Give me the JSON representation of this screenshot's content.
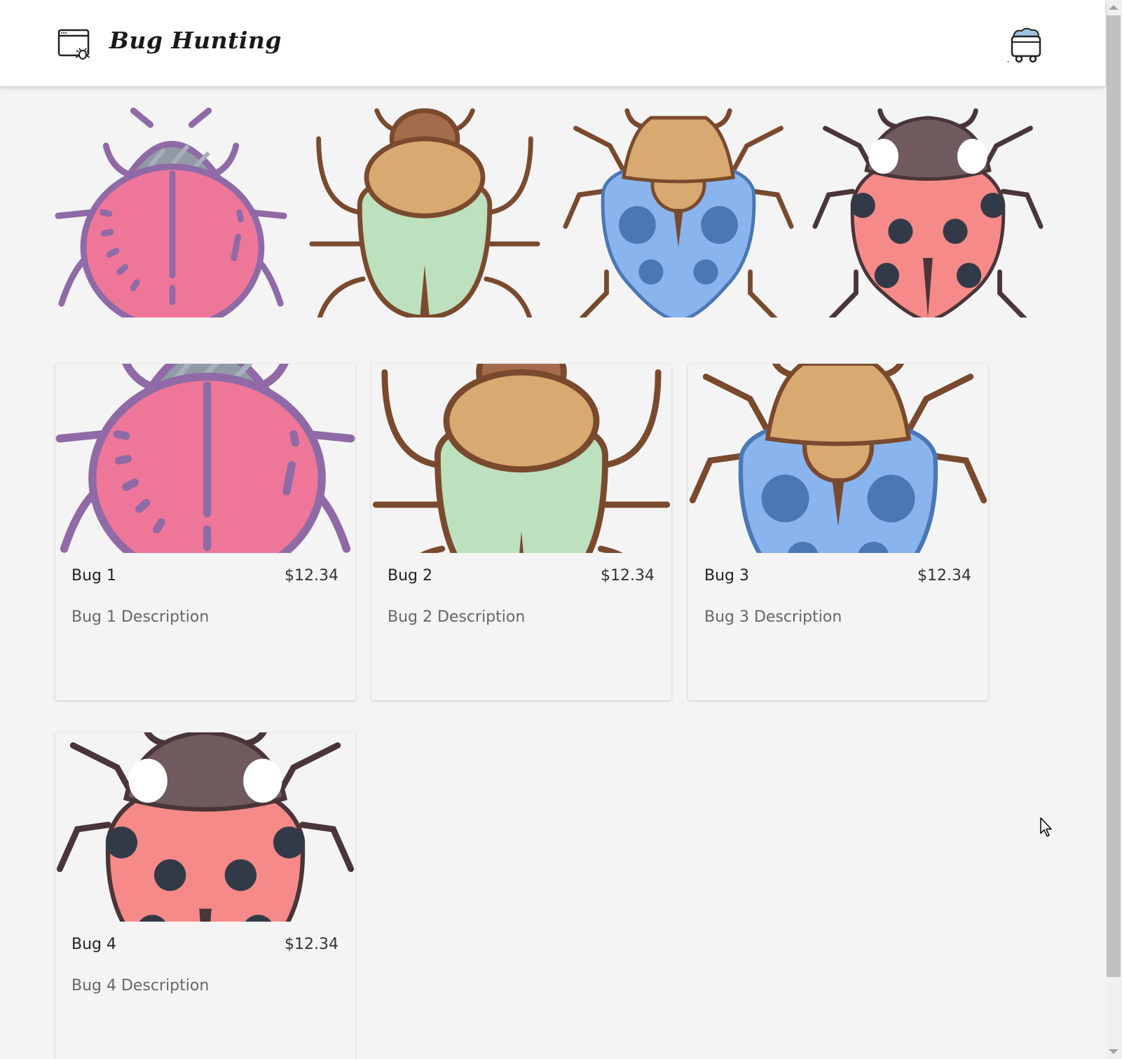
{
  "header": {
    "brand": "Bug Hunting",
    "logo_icon": "browser-bug-icon",
    "cart_icon": "mine-cart-icon"
  },
  "hero": {
    "items": [
      {
        "icon": "pink-beetle-icon",
        "color": "#ee7799"
      },
      {
        "icon": "green-beetle-icon",
        "color": "#bde0be"
      },
      {
        "icon": "blue-beetle-icon",
        "color": "#89b4ee"
      },
      {
        "icon": "ladybug-icon",
        "color": "#f58a88"
      }
    ]
  },
  "products": [
    {
      "name": "Bug 1",
      "price": "$12.34",
      "description": "Bug 1 Description"
    },
    {
      "name": "Bug 2",
      "price": "$12.34",
      "description": "Bug 2 Description"
    },
    {
      "name": "Bug 3",
      "price": "$12.34",
      "description": "Bug 3 Description"
    },
    {
      "name": "Bug 4",
      "price": "$12.34",
      "description": "Bug 4 Description"
    }
  ]
}
